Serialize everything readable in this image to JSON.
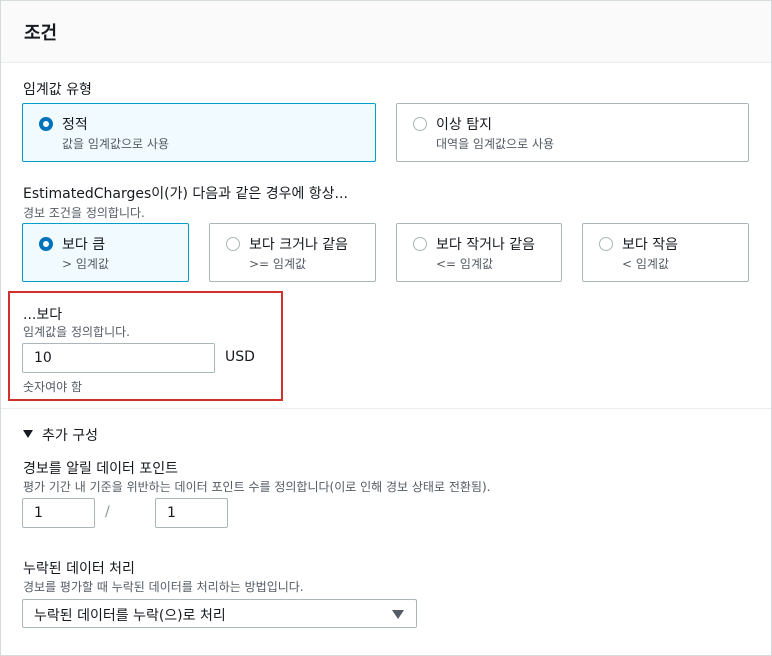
{
  "panel": {
    "title": "조건"
  },
  "threshold_type": {
    "label": "임계값 유형",
    "options": [
      {
        "title": "정적",
        "desc": "값을 임계값으로 사용",
        "selected": true
      },
      {
        "title": "이상 탐지",
        "desc": "대역을 임계값으로 사용",
        "selected": false
      }
    ]
  },
  "condition": {
    "label": "EstimatedCharges이(가) 다음과 같은 경우에 항상...",
    "desc": "경보 조건을 정의합니다.",
    "options": [
      {
        "title": "보다 큼",
        "desc": "> 임계값",
        "selected": true
      },
      {
        "title": "보다 크거나 같음",
        "desc": ">= 임계값",
        "selected": false
      },
      {
        "title": "보다 작거나 같음",
        "desc": "<= 임계값",
        "selected": false
      },
      {
        "title": "보다 작음",
        "desc": "< 임계값",
        "selected": false
      }
    ]
  },
  "threshold": {
    "label": "...보다",
    "desc": "임계값을 정의합니다.",
    "value": "10",
    "unit": "USD",
    "hint": "숫자여야 함"
  },
  "additional": {
    "label": "추가 구성",
    "expanded": true,
    "datapoints": {
      "label": "경보를 알릴 데이터 포인트",
      "desc": "평가 기간 내 기준을 위반하는 데이터 포인트 수를 정의합니다(이로 인해 경보 상태로 전환됨).",
      "value_a": "1",
      "separator": "/",
      "value_b": "1"
    },
    "missing_data": {
      "label": "누락된 데이터 처리",
      "desc": "경보를 평가할 때 누락된 데이터를 처리하는 방법입니다.",
      "selected": "누락된 데이터를 누락(으)로 처리"
    }
  },
  "colors": {
    "selected_border": "#00a1c9",
    "selected_bg": "#f1faff",
    "radio_selected": "#0073bb",
    "highlight": "#d0312d"
  }
}
